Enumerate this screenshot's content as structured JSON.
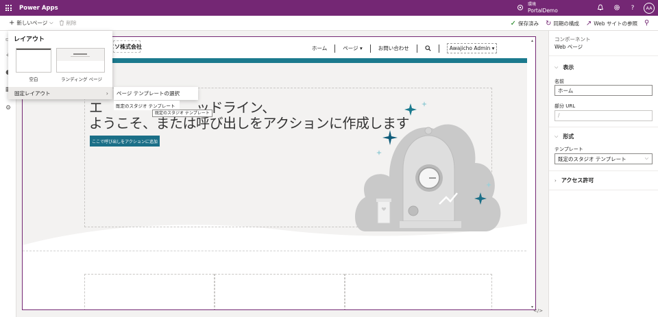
{
  "topbar": {
    "app_name": "Power Apps",
    "env_label": "環境",
    "env_name": "PortalDemo",
    "user_initials": "AA"
  },
  "commandbar": {
    "new_page": "新しいページ",
    "delete": "削除",
    "saved": "保存済み",
    "sync": "同期の構成",
    "browse": "Web サイトの参照"
  },
  "layout_panel": {
    "title": "レイアウト",
    "blank": "空白",
    "landing": "ランディング ページ",
    "fixed": "固定レイアウト"
  },
  "submenu": {
    "select": "ページ テンプレートの選択",
    "default": "既定のスタジオ テンプレート",
    "tooltip": "既定のスタジオ テンプレート"
  },
  "site": {
    "logo": "ソ株式会社",
    "nav": [
      "ホーム",
      "ページ",
      "お問い合わせ"
    ],
    "user": "Awajicho Admin",
    "headline_line1": "エ　　　　　　　ッドライン、",
    "headline_line2": "ようこそ、または呼び出しをアクションに作成します",
    "cta": "ここで呼び出しをアクションに追加"
  },
  "right_panel": {
    "component": "コンポーネント",
    "type": "Web ページ",
    "display_section": "表示",
    "name_label": "名前",
    "name_value": "ホーム",
    "url_label": "部分 URL",
    "url_value": "/",
    "format_section": "形式",
    "template_label": "テンプレート",
    "template_value": "既定のスタジオ テンプレート",
    "access_section": "アクセス許可"
  },
  "colors": {
    "brand": "#742774",
    "teal": "#1b7a8e",
    "cta": "#1b6f87"
  }
}
